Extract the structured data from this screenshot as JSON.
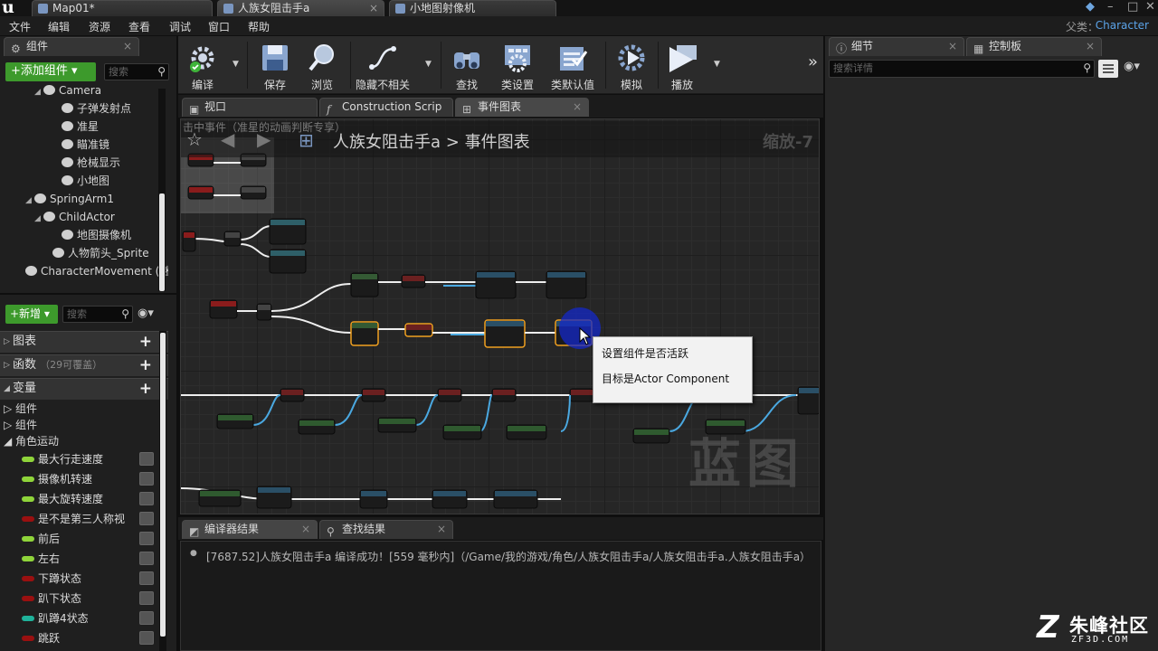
{
  "titlebar": {
    "tabs": [
      {
        "label": "Map01*"
      },
      {
        "label": "人族女阻击手a"
      },
      {
        "label": "小地图射像机"
      }
    ]
  },
  "menubar": {
    "items": [
      "文件",
      "编辑",
      "资源",
      "查看",
      "调试",
      "窗口",
      "帮助"
    ],
    "parent_class_label": "父类：",
    "parent_class_value": "Character"
  },
  "components": {
    "tab_label": "组件",
    "add_button": "+添加组件 ▾",
    "search_placeholder": "搜索",
    "tree": [
      {
        "label": "Camera",
        "indent": 3,
        "expander": "◢"
      },
      {
        "label": "子弹发射点",
        "indent": 5,
        "expander": ""
      },
      {
        "label": "准星",
        "indent": 5,
        "expander": ""
      },
      {
        "label": "瞄准镜",
        "indent": 5,
        "expander": ""
      },
      {
        "label": "枪械显示",
        "indent": 5,
        "expander": ""
      },
      {
        "label": "小地图",
        "indent": 5,
        "expander": ""
      },
      {
        "label": "SpringArm1",
        "indent": 2,
        "expander": "◢"
      },
      {
        "label": "ChildActor",
        "indent": 3,
        "expander": "◢"
      },
      {
        "label": "地图摄像机",
        "indent": 5,
        "expander": ""
      },
      {
        "label": "人物箭头_Sprite",
        "indent": 4,
        "expander": ""
      },
      {
        "label": "CharacterMovement (继",
        "indent": 1,
        "expander": ""
      }
    ]
  },
  "mybp": {
    "add_button": "+新增 ▾",
    "search_placeholder": "搜索",
    "sections": {
      "graphs": "图表",
      "functions": "函数",
      "functions_hint": "（29可覆盖）",
      "variables": "变量"
    },
    "categories": [
      "组件",
      "组件",
      "角色运动"
    ],
    "variables": [
      {
        "name": "最大行走速度",
        "color": "#8fd43a"
      },
      {
        "name": "摄像机转速",
        "color": "#8fd43a"
      },
      {
        "name": "最大旋转速度",
        "color": "#8fd43a"
      },
      {
        "name": "是不是第三人称视",
        "color": "#9a1010"
      },
      {
        "name": "前后",
        "color": "#8fd43a"
      },
      {
        "name": "左右",
        "color": "#8fd43a"
      },
      {
        "name": "下蹲状态",
        "color": "#9a1010"
      },
      {
        "name": "趴下状态",
        "color": "#9a1010"
      },
      {
        "name": "趴蹲4状态",
        "color": "#1fb29a"
      },
      {
        "name": "跳跃",
        "color": "#9a1010"
      }
    ]
  },
  "toolbar": {
    "compile": "编译",
    "save": "保存",
    "browse": "浏览",
    "hide_unrelated": "隐藏不相关",
    "find": "查找",
    "class_settings": "类设置",
    "class_defaults": "类默认值",
    "simulate": "模拟",
    "play": "播放",
    "more": "»"
  },
  "graph": {
    "tabs": [
      {
        "label": "视口",
        "icon": "viewport-icon"
      },
      {
        "label": "Construction Scrip",
        "icon": "function-icon"
      },
      {
        "label": "事件图表",
        "icon": "graph-icon"
      }
    ],
    "comment": "击中事件（准星的动画判断专享）",
    "breadcrumb_bp": "人族女阻击手a",
    "breadcrumb_sep": ">",
    "breadcrumb_graph": "事件图表",
    "zoom": "缩放-7",
    "watermark": "蓝图"
  },
  "tooltip": {
    "line1": "设置组件是否活跃",
    "line2": "目标是Actor Component"
  },
  "results": {
    "tabs": [
      {
        "label": "编译器结果"
      },
      {
        "label": "查找结果"
      }
    ],
    "message": "[7687.52]人族女阻击手a 编译成功！[559 毫秒内]（/Game/我的游戏/角色/人族女阻击手a/人族女阻击手a.人族女阻击手a）"
  },
  "details": {
    "tabs": [
      {
        "label": "细节"
      },
      {
        "label": "控制板"
      }
    ],
    "search_placeholder": "搜索详情"
  },
  "site_logo": {
    "mark": "Z",
    "name": "朱峰社区",
    "url": "ZF3D.COM"
  },
  "colors": {
    "accent_blue": "#5ba3e8",
    "add_green": "#3d9a2c",
    "graph_bg": "#262626"
  }
}
